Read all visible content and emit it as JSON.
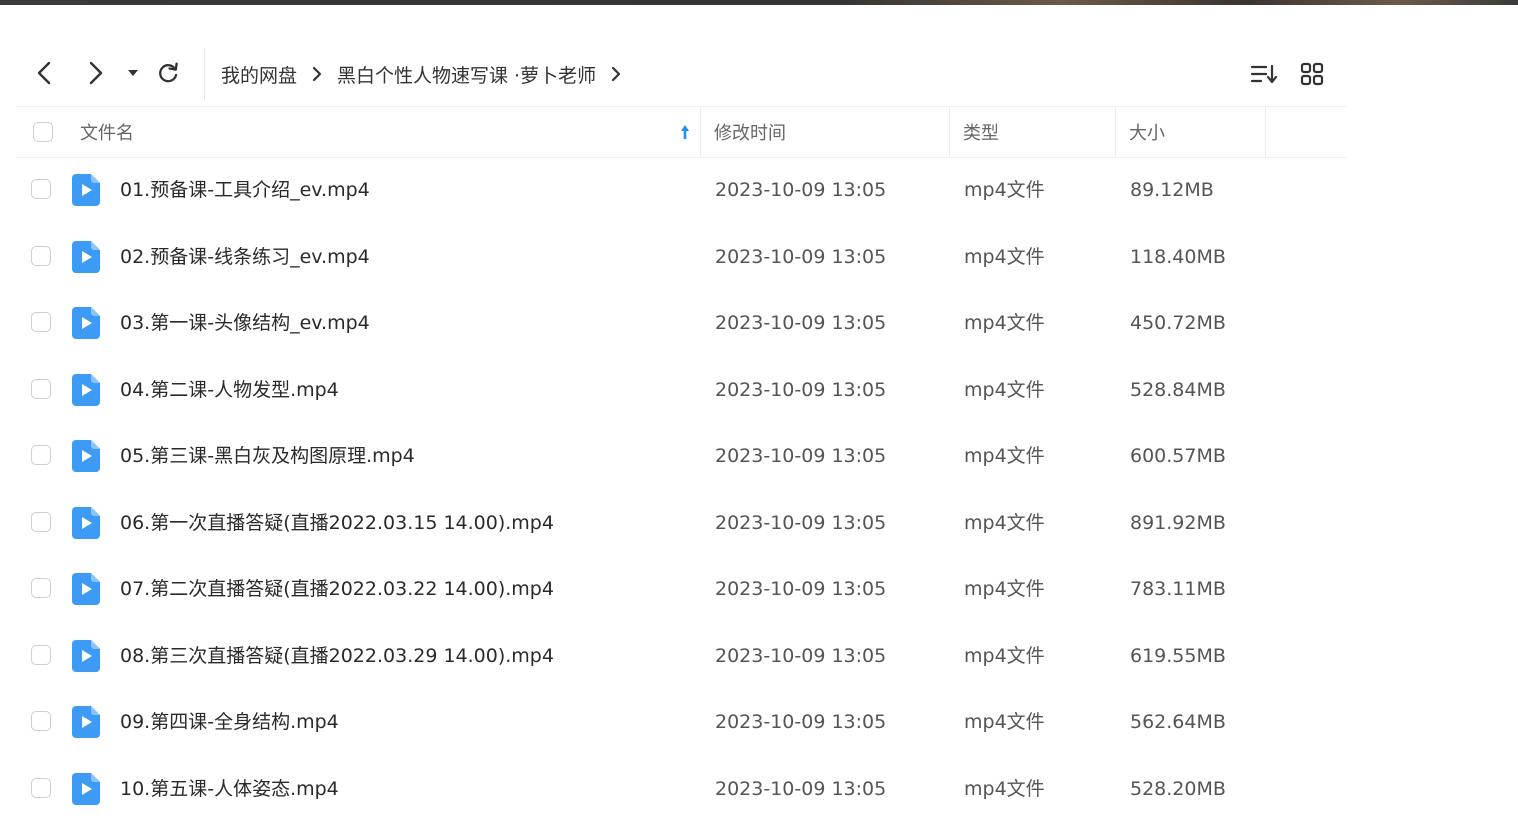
{
  "breadcrumb": {
    "items": [
      "我的网盘",
      "黑白个性人物速写课 ·萝卜老师"
    ]
  },
  "columns": {
    "name": "文件名",
    "modified": "修改时间",
    "type": "类型",
    "size": "大小"
  },
  "sort": {
    "column": "name",
    "direction": "ascending"
  },
  "colors": {
    "accent": "#1e8ef0",
    "file_icon": "#3d9bf5"
  },
  "files": [
    {
      "name": "01.预备课-工具介绍_ev.mp4",
      "modified": "2023-10-09 13:05",
      "type": "mp4文件",
      "size": "89.12MB"
    },
    {
      "name": "02.预备课-线条练习_ev.mp4",
      "modified": "2023-10-09 13:05",
      "type": "mp4文件",
      "size": "118.40MB"
    },
    {
      "name": "03.第一课-头像结构_ev.mp4",
      "modified": "2023-10-09 13:05",
      "type": "mp4文件",
      "size": "450.72MB"
    },
    {
      "name": "04.第二课-人物发型.mp4",
      "modified": "2023-10-09 13:05",
      "type": "mp4文件",
      "size": "528.84MB"
    },
    {
      "name": "05.第三课-黑白灰及构图原理.mp4",
      "modified": "2023-10-09 13:05",
      "type": "mp4文件",
      "size": "600.57MB"
    },
    {
      "name": "06.第一次直播答疑(直播2022.03.15 14.00).mp4",
      "modified": "2023-10-09 13:05",
      "type": "mp4文件",
      "size": "891.92MB"
    },
    {
      "name": "07.第二次直播答疑(直播2022.03.22 14.00).mp4",
      "modified": "2023-10-09 13:05",
      "type": "mp4文件",
      "size": "783.11MB"
    },
    {
      "name": "08.第三次直播答疑(直播2022.03.29 14.00).mp4",
      "modified": "2023-10-09 13:05",
      "type": "mp4文件",
      "size": "619.55MB"
    },
    {
      "name": "09.第四课-全身结构.mp4",
      "modified": "2023-10-09 13:05",
      "type": "mp4文件",
      "size": "562.64MB"
    },
    {
      "name": "10.第五课-人体姿态.mp4",
      "modified": "2023-10-09 13:05",
      "type": "mp4文件",
      "size": "528.20MB"
    }
  ]
}
